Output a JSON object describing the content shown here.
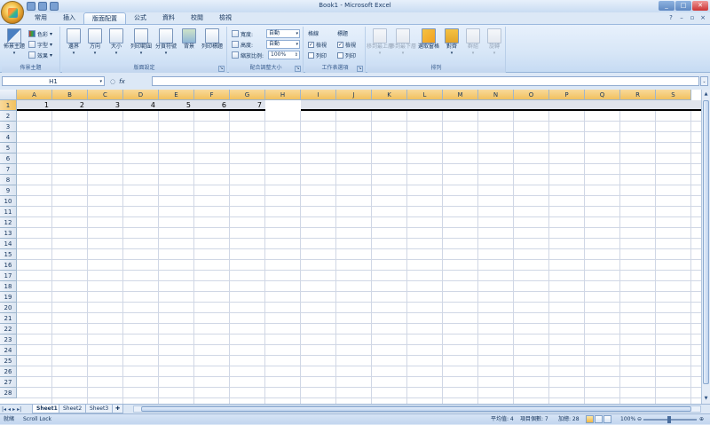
{
  "window": {
    "title": "Book1 - Microsoft Excel"
  },
  "ribbon_tabs": [
    "常用",
    "插入",
    "版面配置",
    "公式",
    "資料",
    "校閱",
    "檢視"
  ],
  "active_tab": "版面配置",
  "ribbon": {
    "themes": {
      "title": "佈景主題",
      "main_label": "佈景主題",
      "colors": "色彩",
      "fonts": "字型",
      "effects": "效果"
    },
    "page_setup": {
      "title": "版面設定",
      "margins": "邊界",
      "orientation": "方向",
      "size": "大小",
      "print_area": "列印範圍",
      "breaks": "分頁符號",
      "background": "背景",
      "print_titles": "列印標題"
    },
    "scale": {
      "title": "配合調整大小",
      "width_label": "寬度:",
      "width_value": "自動",
      "height_label": "高度:",
      "height_value": "自動",
      "scale_label": "縮放比例:",
      "scale_value": "100%"
    },
    "sheet_options": {
      "title": "工作表選項",
      "gridlines": "格線",
      "headings": "標題",
      "view": "檢視",
      "print": "列印"
    },
    "arrange": {
      "title": "排列",
      "bring_front": "移到最上層",
      "send_back": "移到最下層",
      "selection_pane": "選取窗格",
      "align": "對齊",
      "group": "群組",
      "rotate": "旋轉"
    }
  },
  "formula_bar": {
    "name_box": "H1",
    "fx": "fx",
    "value": ""
  },
  "columns": [
    "A",
    "B",
    "C",
    "D",
    "E",
    "F",
    "G",
    "H",
    "I",
    "J",
    "K",
    "L",
    "M",
    "N",
    "O",
    "P",
    "Q",
    "R",
    "S"
  ],
  "rows": [
    "1",
    "2",
    "3",
    "4",
    "5",
    "6",
    "7",
    "8",
    "9",
    "10",
    "11",
    "12",
    "13",
    "14",
    "15",
    "16",
    "17",
    "18",
    "19",
    "20",
    "21",
    "22",
    "23",
    "24",
    "25",
    "26",
    "27",
    "28"
  ],
  "row1_values": [
    "1",
    "2",
    "3",
    "4",
    "5",
    "6",
    "7"
  ],
  "sheets": [
    "Sheet1",
    "Sheet2",
    "Sheet3"
  ],
  "active_sheet": "Sheet1",
  "status": {
    "mode": "就緒",
    "scroll_lock": "Scroll Lock",
    "average": "平均值: 4",
    "count": "項目個數: 7",
    "sum": "加總: 28",
    "zoom": "100%"
  }
}
